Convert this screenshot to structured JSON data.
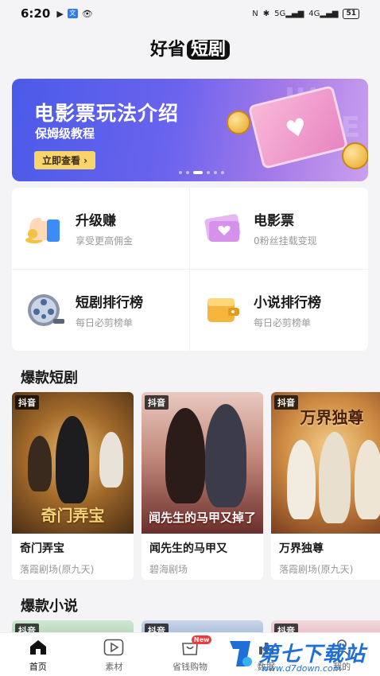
{
  "status_bar": {
    "time": "6:20",
    "battery": "51"
  },
  "header": {
    "title_part1": "好省",
    "title_part2": "短剧"
  },
  "banner": {
    "title": "电影票玩法介绍",
    "subtitle": "保姆级教程",
    "button_label": "立即查看 ›",
    "slide_count": 6,
    "active_slide": 3
  },
  "features": [
    {
      "title": "升级赚",
      "subtitle": "享受更高佣金",
      "icon": "thumbs-up-icon"
    },
    {
      "title": "电影票",
      "subtitle": "0粉丝挂载变现",
      "icon": "movie-ticket-icon"
    },
    {
      "title": "短剧排行榜",
      "subtitle": "每日必剪榜单",
      "icon": "film-reel-icon"
    },
    {
      "title": "小说排行榜",
      "subtitle": "每日必剪榜单",
      "icon": "wallet-book-icon"
    }
  ],
  "sections": {
    "drama_title": "爆款短剧",
    "novel_title": "爆款小说"
  },
  "dramas": [
    {
      "tag": "抖音",
      "name": "奇门弄宝",
      "source": "落霞剧场(原九天)",
      "poster_text": "奇门弄宝"
    },
    {
      "tag": "抖音",
      "name": "闻先生的马甲又",
      "source": "碧海剧场",
      "poster_text": "闻先生的马甲又掉了"
    },
    {
      "tag": "抖音",
      "name": "万界独尊",
      "source": "落霞剧场(原九天)",
      "poster_text": "万界独尊"
    }
  ],
  "novels": [
    {
      "tag": "抖音"
    },
    {
      "tag": "抖音"
    },
    {
      "tag": "抖音"
    }
  ],
  "tabbar": [
    {
      "label": "首页",
      "icon": "home-icon",
      "active": true
    },
    {
      "label": "素材",
      "icon": "play-square-icon",
      "active": false
    },
    {
      "label": "省钱购物",
      "icon": "shopping-bag-icon",
      "active": false,
      "badge": "New"
    },
    {
      "label": "数据",
      "icon": "chart-icon",
      "active": false
    },
    {
      "label": "我的",
      "icon": "user-icon",
      "active": false
    }
  ],
  "watermark": {
    "text": "第七下载站",
    "url": "www.d7down.com"
  },
  "colors": {
    "accent": "#1f6fd6",
    "banner_start": "#4a5be8",
    "banner_end": "#c9a0ef",
    "badge": "#f03a3a"
  }
}
